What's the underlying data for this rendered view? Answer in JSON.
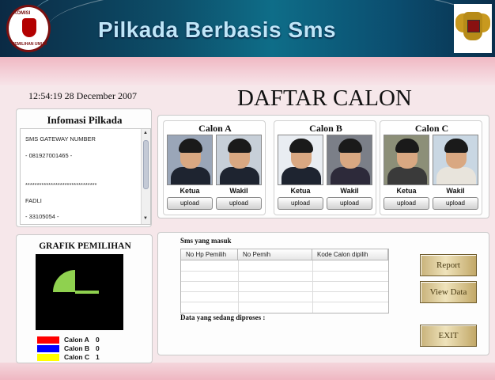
{
  "header": {
    "title": "Pilkada Berbasis Sms",
    "logo_top": "KOMISI",
    "logo_bottom": "PEMILIHAN UMUM"
  },
  "clock": "12:54:19   28  December  2007",
  "page_title": "DAFTAR CALON",
  "info": {
    "title": "Infomasi Pilkada",
    "lines": [
      "SMS GATEWAY NUMBER",
      "- 081927001465 -",
      "*******************************",
      "FADLI",
      "- 33105054 -"
    ],
    "scroll_up": "▲",
    "scroll_down": "▼"
  },
  "candidates": [
    {
      "title": "Calon A",
      "ketua": "Ketua",
      "wakil": "Wakil",
      "upload1": "upload",
      "upload2": "upload"
    },
    {
      "title": "Calon B",
      "ketua": "Ketua",
      "wakil": "Wakil",
      "upload1": "upload",
      "upload2": "upload"
    },
    {
      "title": "Calon C",
      "ketua": "Ketua",
      "wakil": "Wakil",
      "upload1": "upload",
      "upload2": "upload"
    }
  ],
  "grafik": {
    "title": "GRAFIK PEMILIHAN",
    "legend": [
      {
        "name": "Calon A",
        "value": "0",
        "color": "#ff0000"
      },
      {
        "name": "Calon B",
        "value": "0",
        "color": "#0000ff"
      },
      {
        "name": "Calon C",
        "value": "1",
        "color": "#ffff00"
      }
    ],
    "pie_color": "#8fd14f"
  },
  "chart_data": {
    "type": "pie",
    "categories": [
      "Calon A",
      "Calon B",
      "Calon C"
    ],
    "values": [
      0,
      0,
      1
    ],
    "title": "GRAFIK PEMILIHAN"
  },
  "sms": {
    "label": "Sms yang masuk",
    "columns": [
      "No Hp Pemilih",
      "No Pemih",
      "Kode Calon dipilih"
    ],
    "rows": [],
    "processing_label": "Data yang sedang diproses :"
  },
  "buttons": {
    "report": "Report",
    "view": "View Data",
    "exit": "EXIT"
  }
}
